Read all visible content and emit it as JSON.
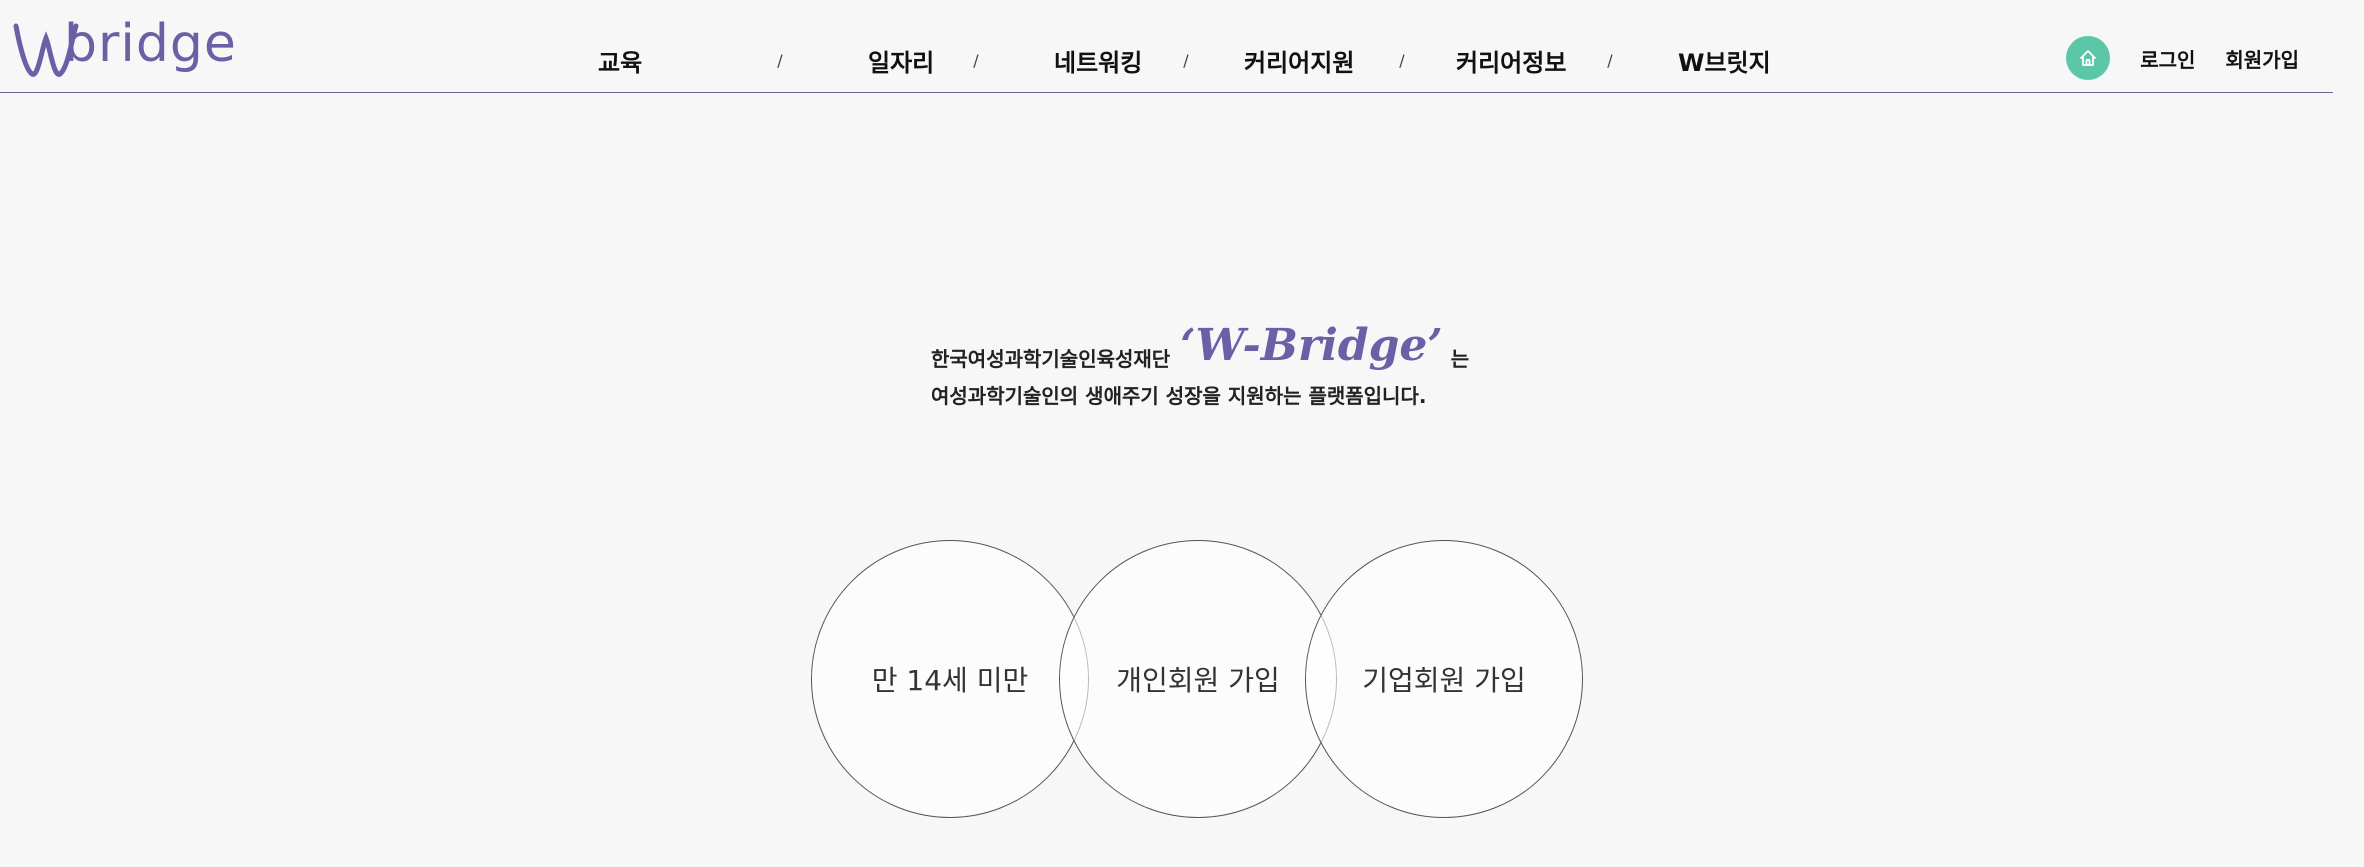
{
  "header": {
    "logo_text": "bridge",
    "nav": [
      {
        "label": "교육"
      },
      {
        "label": "일자리"
      },
      {
        "label": "네트워킹"
      },
      {
        "label": "커리어지원"
      },
      {
        "label": "커리어정보"
      },
      {
        "label": "W브릿지"
      }
    ],
    "separator": "/",
    "home_icon": "home-icon",
    "login_label": "로그인",
    "signup_label": "회원가입",
    "accent_color": "#5cc7a8",
    "brand_color": "#6b5fa6"
  },
  "intro": {
    "org_name": "한국여성과학기술인육성재단",
    "brand_script": "‘W-Bridge’",
    "particle": "는",
    "description": "여성과학기술인의 생애주기 성장을 지원하는 플랫폼입니다."
  },
  "join_options": [
    {
      "label": "만 14세 미만"
    },
    {
      "label": "개인회원 가입"
    },
    {
      "label": "기업회원 가입"
    }
  ]
}
